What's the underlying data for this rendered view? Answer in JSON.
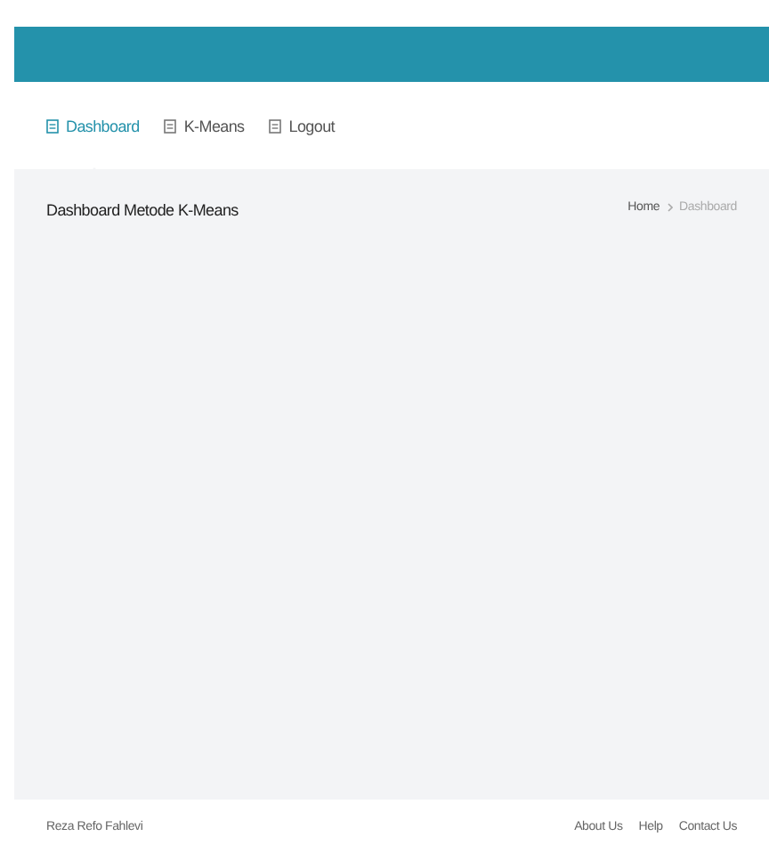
{
  "nav": [
    {
      "label": "Dashboard",
      "selected": true
    },
    {
      "label": "K-Means",
      "selected": false
    },
    {
      "label": "Logout",
      "selected": false
    }
  ],
  "page": {
    "title": "Dashboard Metode K-Means",
    "breadcrumbs": [
      "Home",
      "Dashboard"
    ]
  },
  "footer": {
    "author": "Reza Refo Fahlevi",
    "links": [
      "About Us",
      "Help",
      "Contact Us"
    ]
  }
}
